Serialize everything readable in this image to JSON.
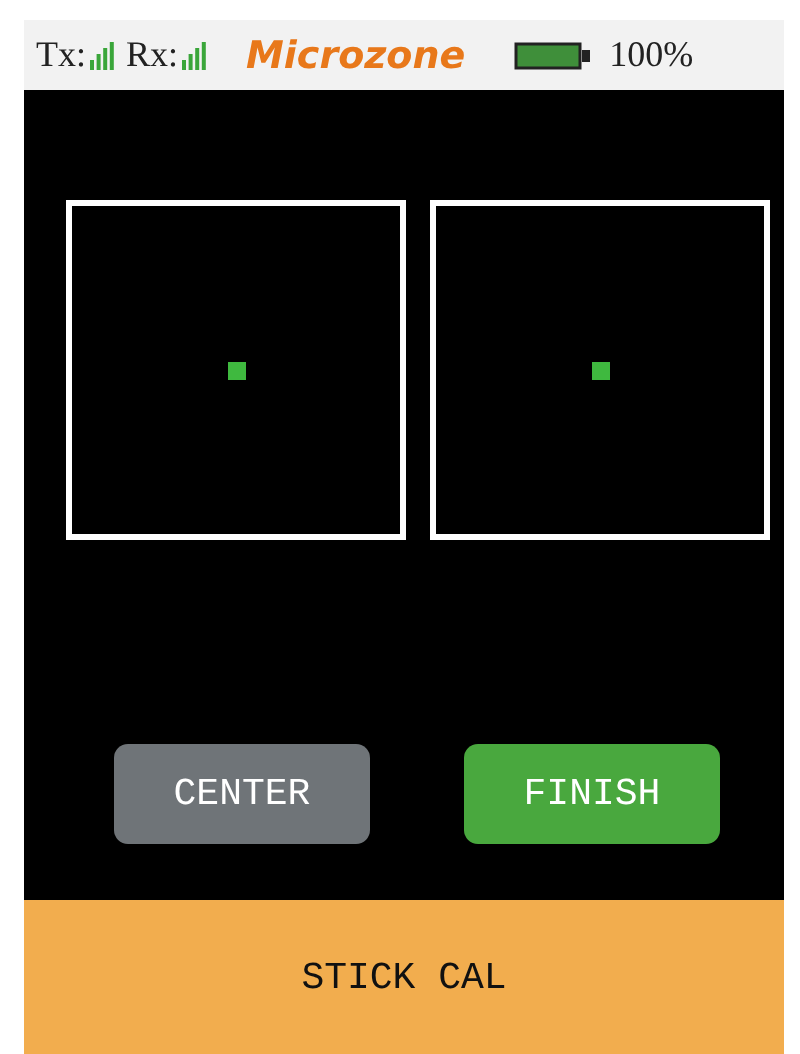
{
  "status_bar": {
    "tx_label": "Tx:",
    "rx_label": "Rx:",
    "brand": "Microzone",
    "battery": "100%"
  },
  "buttons": [
    {
      "label": "CENTER",
      "selected": false
    },
    {
      "label": "FINISH",
      "selected": true
    }
  ],
  "footer": {
    "title": "STICK CAL"
  }
}
